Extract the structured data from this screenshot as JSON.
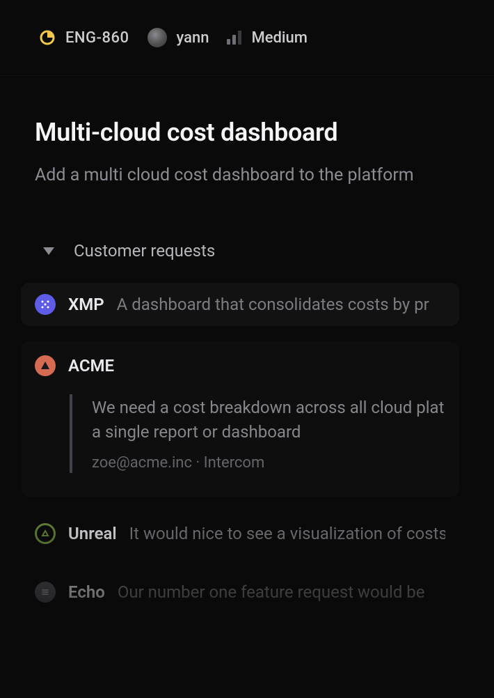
{
  "header": {
    "issue_id": "ENG-860",
    "assignee": "yann",
    "priority": "Medium"
  },
  "issue": {
    "title": "Multi-cloud cost dashboard",
    "subtitle": "Add a multi cloud cost dashboard to the platform"
  },
  "section": {
    "label": "Customer requests"
  },
  "requests": {
    "xmp": {
      "name": "XMP",
      "summary": "A dashboard that consolidates costs by pr"
    },
    "acme": {
      "name": "ACME",
      "quote": "We need a cost breakdown across all cloud plat a single report or dashboard",
      "meta": "zoe@acme.inc · Intercom"
    },
    "unreal": {
      "name": "Unreal",
      "summary": "It would nice to see a visualization of costs"
    },
    "echo": {
      "name": "Echo",
      "summary": "Our number one feature request would be"
    }
  }
}
